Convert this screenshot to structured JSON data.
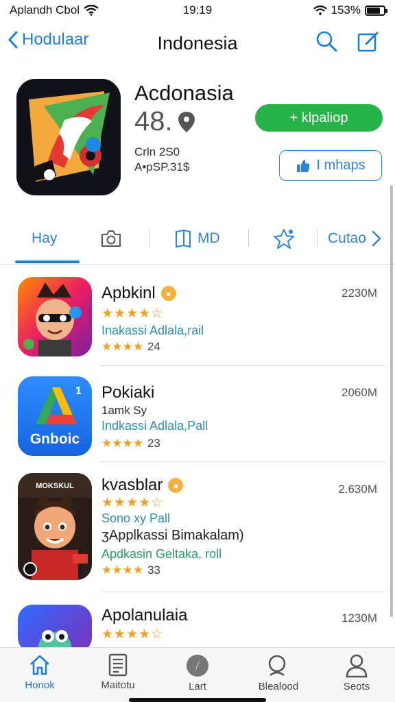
{
  "status_bar": {
    "carrier": "Aplandh Cbol",
    "time": "19:19",
    "battery": "153%",
    "battery_fill_fraction": 0.8
  },
  "nav": {
    "back_label": "Hodulaar",
    "title": "Indonesia",
    "search_icon": "search-icon",
    "compose_icon": "compose-icon"
  },
  "app": {
    "title": "Acdonasia",
    "rating": "48.",
    "meta_line1": "Crln 2S0",
    "meta_line2": "A•pSP.31$",
    "install_label": "+ klpaliop",
    "secondary_label": "I mhaps"
  },
  "tabs": [
    {
      "label": "Hay",
      "active": true
    },
    {
      "label": "",
      "icon": "camera-icon"
    },
    {
      "label": "MD",
      "icon": "book-icon"
    },
    {
      "label": "",
      "icon": "star-icon"
    },
    {
      "label": "Cutao",
      "icon": "chevron-right-icon"
    }
  ],
  "list": [
    {
      "title": "Apbkinl",
      "size": "2230M",
      "stars": "★★★★☆",
      "sub": "Inakassi Adlala,rail",
      "small_stars": "★★★★",
      "small_count": "24"
    },
    {
      "title": "Pokiaki",
      "size": "2060M",
      "sub_dark": "1amk Sy",
      "sub": "Indkassi Adlala,Pall",
      "small_stars": "★★★★",
      "small_count": "23",
      "icon_text": "Gnboic"
    },
    {
      "title": "kvasblar",
      "size": "2.630M",
      "stars": "★★★★☆",
      "sub": "Sono xy Pall",
      "sub_dark": "ʒApplkassi Bimakalam)",
      "sub2": "Apdkasin Geltaka, roll",
      "small_stars": "★★★★",
      "small_count": "33",
      "icon_text": "MOKSKUL"
    },
    {
      "title": "Apolanulaia",
      "size": "1230M",
      "stars": "★★★★☆"
    }
  ],
  "tab_bar": [
    {
      "label": "Honok",
      "icon": "home-icon",
      "active": true
    },
    {
      "label": "Maitotu",
      "icon": "document-icon"
    },
    {
      "label": "Lart",
      "icon": "compass-icon"
    },
    {
      "label": "Blealood",
      "icon": "search-icon"
    },
    {
      "label": "Seots",
      "icon": "person-icon"
    }
  ]
}
